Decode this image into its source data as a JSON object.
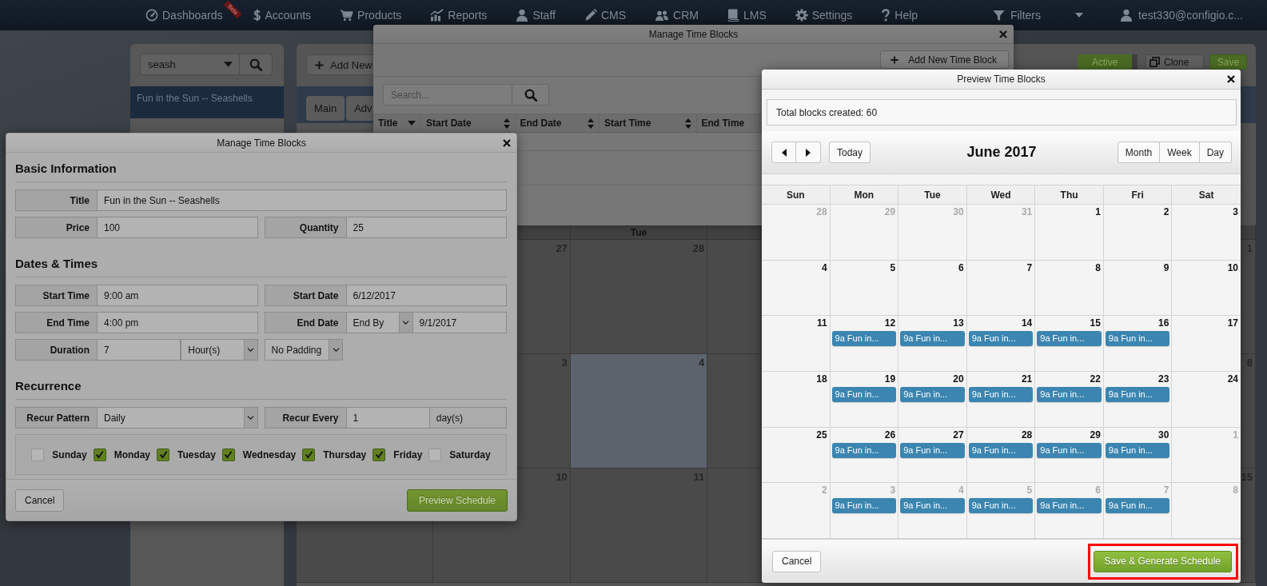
{
  "nav": {
    "items": [
      {
        "label": "Dashboards",
        "badge": "Beta"
      },
      {
        "label": "Accounts"
      },
      {
        "label": "Products"
      },
      {
        "label": "Reports"
      },
      {
        "label": "Staff"
      },
      {
        "label": "CMS"
      },
      {
        "label": "CRM"
      },
      {
        "label": "LMS"
      },
      {
        "label": "Settings"
      },
      {
        "label": "Help"
      }
    ],
    "filters": {
      "label": "Filters"
    },
    "user": {
      "label": "test330@configio.c..."
    }
  },
  "sidebar": {
    "search": {
      "value": "seash"
    },
    "items": [
      {
        "label": "Fun in the Sun -- Seashells",
        "selected": true
      }
    ]
  },
  "main": {
    "add_button": "Add New",
    "status_toggle": {
      "label": "Active",
      "on": true
    },
    "clone_button": "Clone",
    "save_button": "Save",
    "tabs": [
      {
        "label": "Main"
      },
      {
        "label": "Adv"
      }
    ],
    "calendar": {
      "day_headers": [
        {
          "label": "Tue"
        }
      ],
      "weeks": [
        {
          "cells": [
            {
              "date": "27",
              "today": false
            },
            {
              "date": "28",
              "today": false
            },
            {
              "today": false
            },
            {
              "date": "1",
              "today": false
            }
          ]
        },
        {
          "cells": [
            {
              "date": "3",
              "today": false
            },
            {
              "date": "4",
              "today": true
            },
            {
              "today": false
            },
            {
              "date": "8",
              "today": false
            }
          ]
        },
        {
          "cells": [
            {
              "today": false
            },
            {
              "date": "10",
              "today": false
            },
            {
              "date": "11",
              "today": false
            },
            {
              "today": false
            },
            {
              "date": "15",
              "today": false
            }
          ]
        }
      ]
    }
  },
  "list_dialog": {
    "title": "Manage Time Blocks",
    "add_button": "Add New Time Block",
    "search": {
      "placeholder": "Search..."
    },
    "columns": [
      {
        "label": "Title",
        "sorted": true
      },
      {
        "label": "Start Date",
        "sorted": false
      },
      {
        "label": "End Date",
        "sorted": false
      },
      {
        "label": "Start Time",
        "sorted": false
      },
      {
        "label": "End Time"
      }
    ]
  },
  "form_dialog": {
    "title": "Manage Time Blocks",
    "sections": [
      {
        "heading": "Basic Information",
        "rows": [
          {
            "groups": [
              {
                "parts": [
                  {
                    "kind": "label",
                    "text": "Title"
                  },
                  {
                    "kind": "input",
                    "text": "Fun in the Sun -- Seashells"
                  }
                ]
              }
            ]
          },
          {
            "groups": [
              {
                "parts": [
                  {
                    "kind": "label",
                    "text": "Price"
                  },
                  {
                    "kind": "input",
                    "text": "100"
                  }
                ]
              },
              {
                "parts": [
                  {
                    "kind": "label",
                    "text": "Quantity"
                  },
                  {
                    "kind": "input",
                    "text": "25"
                  }
                ]
              }
            ]
          }
        ]
      },
      {
        "heading": "Dates & Times",
        "rows": [
          {
            "groups": [
              {
                "parts": [
                  {
                    "kind": "label",
                    "text": "Start Time"
                  },
                  {
                    "kind": "input",
                    "text": "9:00 am"
                  }
                ]
              },
              {
                "parts": [
                  {
                    "kind": "label",
                    "text": "Start Date"
                  },
                  {
                    "kind": "input",
                    "text": "6/12/2017"
                  }
                ]
              }
            ]
          },
          {
            "groups": [
              {
                "parts": [
                  {
                    "kind": "label",
                    "text": "End Time"
                  },
                  {
                    "kind": "input",
                    "text": "4:00 pm"
                  }
                ]
              },
              {
                "parts": [
                  {
                    "kind": "label",
                    "text": "End Date"
                  },
                  {
                    "kind": "select",
                    "text": "End By"
                  },
                  {
                    "kind": "input",
                    "text": "9/1/2017"
                  }
                ]
              }
            ]
          },
          {
            "groups": [
              {
                "parts": [
                  {
                    "kind": "label",
                    "text": "Duration"
                  },
                  {
                    "kind": "input",
                    "text": "7"
                  },
                  {
                    "kind": "select",
                    "text": "Hour(s)"
                  }
                ]
              },
              {
                "parts": [
                  {
                    "kind": "select",
                    "text": "No Padding"
                  }
                ]
              }
            ]
          }
        ]
      },
      {
        "heading": "Recurrence",
        "rows": [
          {
            "groups": [
              {
                "parts": [
                  {
                    "kind": "label",
                    "text": "Recur Pattern"
                  },
                  {
                    "kind": "select",
                    "text": "Daily"
                  }
                ]
              },
              {
                "parts": [
                  {
                    "kind": "label",
                    "text": "Recur Every"
                  },
                  {
                    "kind": "input",
                    "text": "1"
                  },
                  {
                    "kind": "addon",
                    "text": "day(s)"
                  }
                ]
              }
            ]
          }
        ],
        "days": [
          {
            "label": "Sunday",
            "checked": false
          },
          {
            "label": "Monday",
            "checked": true
          },
          {
            "label": "Tuesday",
            "checked": true
          },
          {
            "label": "Wednesday",
            "checked": true
          },
          {
            "label": "Thursday",
            "checked": true
          },
          {
            "label": "Friday",
            "checked": true
          },
          {
            "label": "Saturday",
            "checked": false
          }
        ]
      }
    ],
    "cancel_button": "Cancel",
    "submit_button": "Preview Schedule"
  },
  "preview_dialog": {
    "title": "Preview Time Blocks",
    "summary": "Total blocks created: 60",
    "calendar": {
      "title": "June 2017",
      "today_button": "Today",
      "views": [
        {
          "label": "Month"
        },
        {
          "label": "Week"
        },
        {
          "label": "Day"
        }
      ],
      "day_headers": [
        "Sun",
        "Mon",
        "Tue",
        "Wed",
        "Thu",
        "Fri",
        "Sat"
      ],
      "weeks": [
        {
          "days": [
            {
              "date": "28",
              "other_month": true
            },
            {
              "date": "29",
              "other_month": true
            },
            {
              "date": "30",
              "other_month": true
            },
            {
              "date": "31",
              "other_month": true
            },
            {
              "date": "1",
              "other_month": false
            },
            {
              "date": "2",
              "other_month": false
            },
            {
              "date": "3",
              "other_month": false
            }
          ]
        },
        {
          "days": [
            {
              "date": "4",
              "other_month": false
            },
            {
              "date": "5",
              "other_month": false
            },
            {
              "date": "6",
              "other_month": false
            },
            {
              "date": "7",
              "other_month": false
            },
            {
              "date": "8",
              "other_month": false
            },
            {
              "date": "9",
              "other_month": false
            },
            {
              "date": "10",
              "other_month": false
            }
          ]
        },
        {
          "days": [
            {
              "date": "11",
              "other_month": false
            },
            {
              "date": "12",
              "other_month": false,
              "events": [
                "9a Fun in..."
              ]
            },
            {
              "date": "13",
              "other_month": false,
              "events": [
                "9a Fun in..."
              ]
            },
            {
              "date": "14",
              "other_month": false,
              "events": [
                "9a Fun in..."
              ]
            },
            {
              "date": "15",
              "other_month": false,
              "events": [
                "9a Fun in..."
              ]
            },
            {
              "date": "16",
              "other_month": false,
              "events": [
                "9a Fun in..."
              ]
            },
            {
              "date": "17",
              "other_month": false
            }
          ]
        },
        {
          "days": [
            {
              "date": "18",
              "other_month": false
            },
            {
              "date": "19",
              "other_month": false,
              "events": [
                "9a Fun in..."
              ]
            },
            {
              "date": "20",
              "other_month": false,
              "events": [
                "9a Fun in..."
              ]
            },
            {
              "date": "21",
              "other_month": false,
              "events": [
                "9a Fun in..."
              ]
            },
            {
              "date": "22",
              "other_month": false,
              "events": [
                "9a Fun in..."
              ]
            },
            {
              "date": "23",
              "other_month": false,
              "events": [
                "9a Fun in..."
              ]
            },
            {
              "date": "24",
              "other_month": false
            }
          ]
        },
        {
          "days": [
            {
              "date": "25",
              "other_month": false
            },
            {
              "date": "26",
              "other_month": false,
              "events": [
                "9a Fun in..."
              ]
            },
            {
              "date": "27",
              "other_month": false,
              "events": [
                "9a Fun in..."
              ]
            },
            {
              "date": "28",
              "other_month": false,
              "events": [
                "9a Fun in..."
              ]
            },
            {
              "date": "29",
              "other_month": false,
              "events": [
                "9a Fun in..."
              ]
            },
            {
              "date": "30",
              "other_month": false,
              "events": [
                "9a Fun in..."
              ]
            },
            {
              "date": "1",
              "other_month": true
            }
          ]
        },
        {
          "days": [
            {
              "date": "2",
              "other_month": true
            },
            {
              "date": "3",
              "other_month": true,
              "events": [
                "9a Fun in..."
              ]
            },
            {
              "date": "4",
              "other_month": true,
              "events": [
                "9a Fun in..."
              ]
            },
            {
              "date": "5",
              "other_month": true,
              "events": [
                "9a Fun in..."
              ]
            },
            {
              "date": "6",
              "other_month": true,
              "events": [
                "9a Fun in..."
              ]
            },
            {
              "date": "7",
              "other_month": true,
              "events": [
                "9a Fun in..."
              ]
            },
            {
              "date": "8",
              "other_month": true
            }
          ]
        }
      ]
    },
    "cancel_button": "Cancel",
    "submit_button": "Save & Generate Schedule",
    "submit_highlighted": true
  }
}
